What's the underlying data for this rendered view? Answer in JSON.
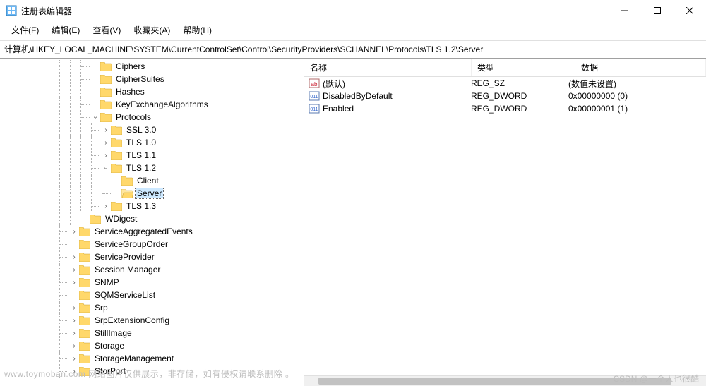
{
  "window": {
    "title": "注册表编辑器"
  },
  "menu": {
    "file": "文件(F)",
    "edit": "编辑(E)",
    "view": "查看(V)",
    "favorites": "收藏夹(A)",
    "help": "帮助(H)"
  },
  "address": "计算机\\HKEY_LOCAL_MACHINE\\SYSTEM\\CurrentControlSet\\Control\\SecurityProviders\\SCHANNEL\\Protocols\\TLS 1.2\\Server",
  "tree": {
    "ciphers": "Ciphers",
    "ciphersuites": "CipherSuites",
    "hashes": "Hashes",
    "kea": "KeyExchangeAlgorithms",
    "protocols": "Protocols",
    "ssl30": "SSL 3.0",
    "tls10": "TLS 1.0",
    "tls11": "TLS 1.1",
    "tls12": "TLS 1.2",
    "client": "Client",
    "server": "Server",
    "tls13": "TLS 1.3",
    "wdigest": "WDigest",
    "sae": "ServiceAggregatedEvents",
    "sgo": "ServiceGroupOrder",
    "sp": "ServiceProvider",
    "sm": "Session Manager",
    "snmp": "SNMP",
    "sqm": "SQMServiceList",
    "srp": "Srp",
    "sec": "SrpExtensionConfig",
    "still": "StillImage",
    "storage": "Storage",
    "stm": "StorageManagement",
    "storport": "StorPort"
  },
  "columns": {
    "name": "名称",
    "type": "类型",
    "data": "数据"
  },
  "values": [
    {
      "name": "(默认)",
      "type": "REG_SZ",
      "data": "(数值未设置)",
      "icon": "string"
    },
    {
      "name": "DisabledByDefault",
      "type": "REG_DWORD",
      "data": "0x00000000 (0)",
      "icon": "binary"
    },
    {
      "name": "Enabled",
      "type": "REG_DWORD",
      "data": "0x00000001 (1)",
      "icon": "binary"
    }
  ],
  "watermarks": {
    "left": "www.toymoban.com 网络图片仅供展示，非存储，如有侵权请联系删除 。",
    "right": "CSDN @一个人也很酷"
  }
}
